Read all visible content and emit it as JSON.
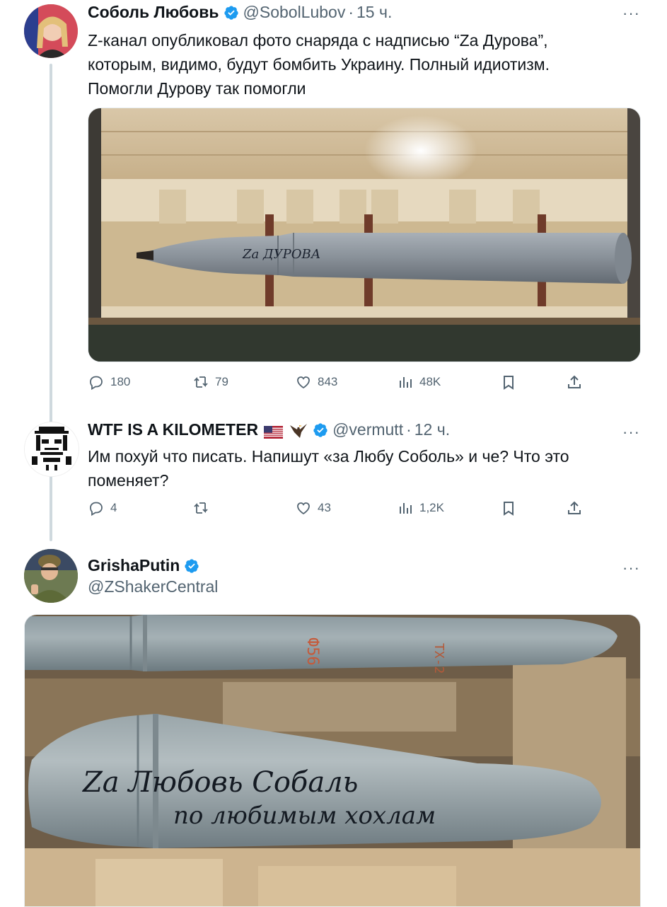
{
  "tweets": [
    {
      "name": "Соболь Любовь",
      "handle": "@SobolLubov",
      "time": "15 ч.",
      "more": "···",
      "text_lines": [
        "Z-канал опубликовал фото снаряда с надписью “Za Дурова”,",
        "которым, видимо, будут бомбить Украину. Полный идиотизм.",
        "Помогли Дурову так помогли"
      ],
      "image_inscription": "Za ДУРОВА",
      "stats": {
        "replies": "180",
        "reposts": "79",
        "likes": "843",
        "views": "48K"
      }
    },
    {
      "name": "WTF IS A KILOMETER",
      "handle": "@vermutt",
      "time": "12 ч.",
      "more": "···",
      "text_lines": [
        "Им похуй что писать. Напишут «за Любу Соболь» и че? Что это",
        "поменяет?"
      ],
      "stats": {
        "replies": "4",
        "reposts": "",
        "likes": "43",
        "views": "1,2K"
      }
    },
    {
      "name": "GrishaPutin",
      "handle": "@ZShakerCentral",
      "more": "···",
      "image_inscription_line1": "Za Любовь Собаль",
      "image_inscription_line2": "по любимым хохлам",
      "image_stencil_1": "Ф56",
      "image_stencil_2": "ТХ-2"
    }
  ],
  "colors": {
    "accent": "#1d9bf0",
    "secondary_text": "#536471",
    "thread_line": "#cfd9de"
  }
}
